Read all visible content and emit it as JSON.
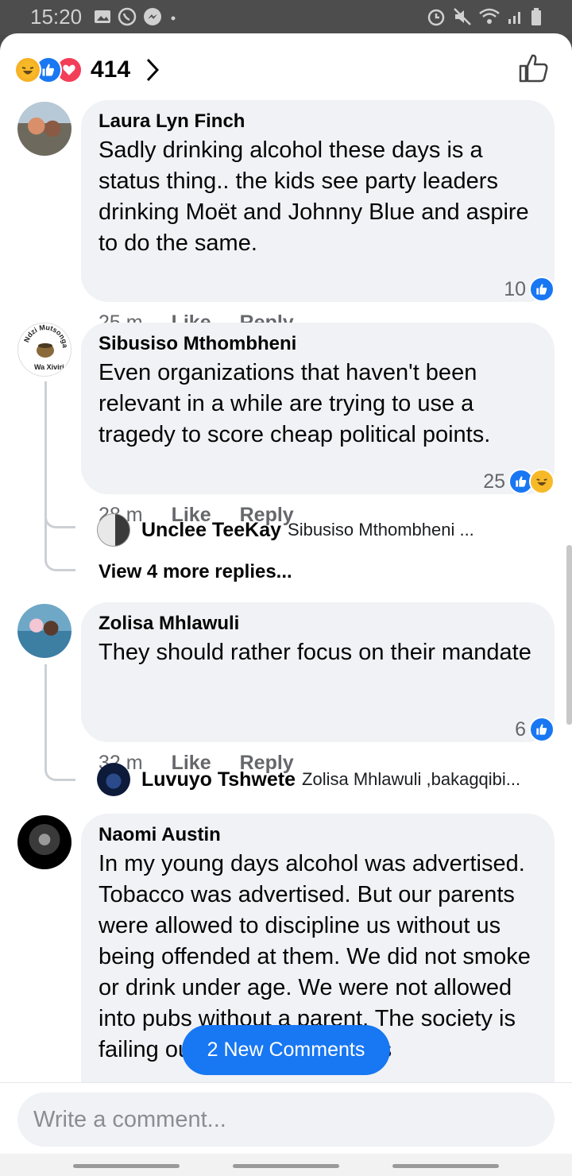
{
  "status": {
    "time": "15:20"
  },
  "reactions": {
    "count": "414"
  },
  "comments": [
    {
      "author": "Laura Lyn Finch",
      "text": "Sadly drinking alcohol these days is a status thing.. the kids see party leaders drinking Moët and Johnny Blue and aspire to do the same.",
      "time": "25 m",
      "like": "Like",
      "reply": "Reply",
      "reactions": "10"
    },
    {
      "author": "Sibusiso Mthombheni",
      "text": "Even organizations that haven't been relevant in a while are trying to use a tragedy to score cheap political points.",
      "time": "28 m",
      "like": "Like",
      "reply": "Reply",
      "reactions": "25",
      "reply_preview": {
        "name": "Unclee TeeKay",
        "snippet": "Sibusiso Mthombheni ..."
      },
      "view_more": "View 4 more replies...",
      "avatar_text": [
        "Ndzi Mutsonga",
        "Wa Xiviri"
      ]
    },
    {
      "author": "Zolisa Mhlawuli",
      "text": "They should rather focus on their mandate",
      "time": "32 m",
      "like": "Like",
      "reply": "Reply",
      "reactions": "6",
      "reply_preview": {
        "name": "Luvuyo Tshwete",
        "snippet": "Zolisa Mhlawuli ,bakagqibi..."
      }
    },
    {
      "author": "Naomi Austin",
      "text": "In my young days alcohol was advertised. Tobacco was advertised. But our parents were allowed to discipline us without us being offended at them. We did not smoke or drink under age. We were not allowed into pubs without a parent. The society is failing our youth. Not adverts"
    }
  ],
  "new_comments_label": "2 New Comments",
  "composer": {
    "placeholder": "Write a comment..."
  },
  "colors": {
    "accent": "#1877f2",
    "bubble": "#f0f2f5",
    "meta": "#65676b"
  }
}
